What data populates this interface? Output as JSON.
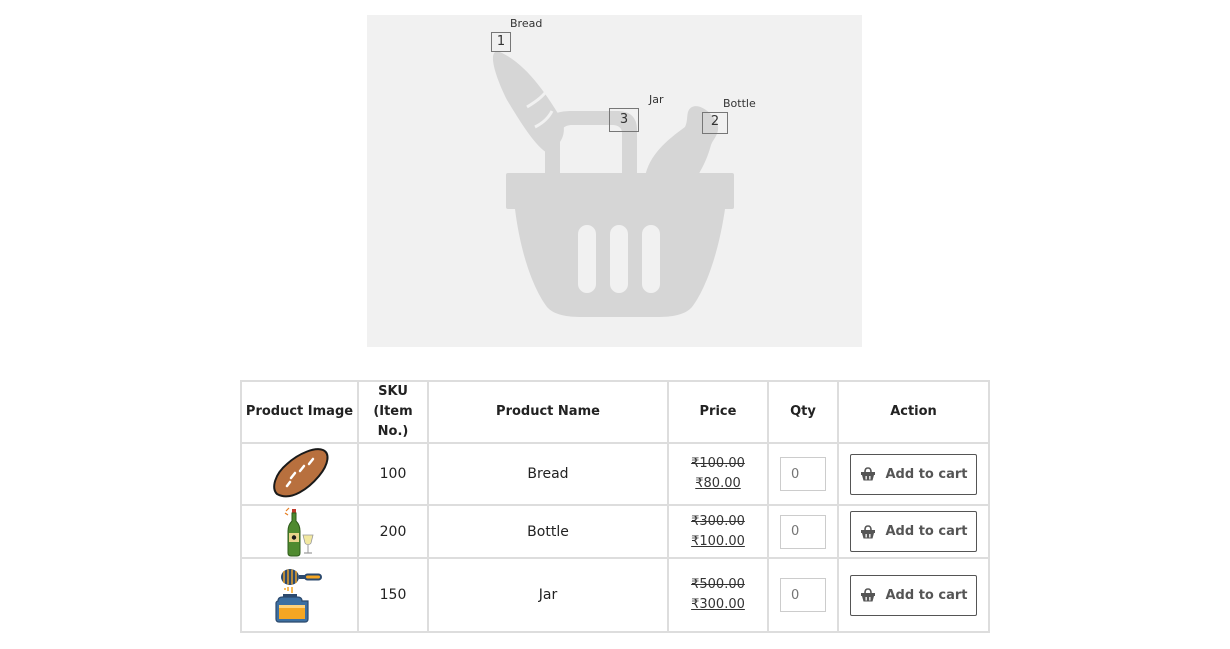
{
  "hero": {
    "hotspots": [
      {
        "number": "1",
        "label": "Bread"
      },
      {
        "number": "2",
        "label": "Bottle"
      },
      {
        "number": "3",
        "label": "Jar"
      }
    ]
  },
  "table": {
    "headers": {
      "image": "Product Image",
      "sku_line1": "SKU",
      "sku_line2": "(Item No.)",
      "name": "Product Name",
      "price": "Price",
      "qty": "Qty",
      "action": "Action"
    },
    "rows": [
      {
        "icon": "bread-icon",
        "sku": "100",
        "name": "Bread",
        "old_price": "₹100.00",
        "new_price": "₹80.00",
        "qty_placeholder": "0",
        "button": "Add to cart"
      },
      {
        "icon": "bottle-icon",
        "sku": "200",
        "name": "Bottle",
        "old_price": "₹300.00",
        "new_price": "₹100.00",
        "qty_placeholder": "0",
        "button": "Add to cart"
      },
      {
        "icon": "jar-icon",
        "sku": "150",
        "name": "Jar",
        "old_price": "₹500.00",
        "new_price": "₹300.00",
        "qty_placeholder": "0",
        "button": "Add to cart"
      }
    ]
  },
  "colors": {
    "hero_background": "#f1f1f1",
    "basket": "#d6d6d6",
    "table_border": "#dddddd",
    "bread": "#b8703e"
  }
}
